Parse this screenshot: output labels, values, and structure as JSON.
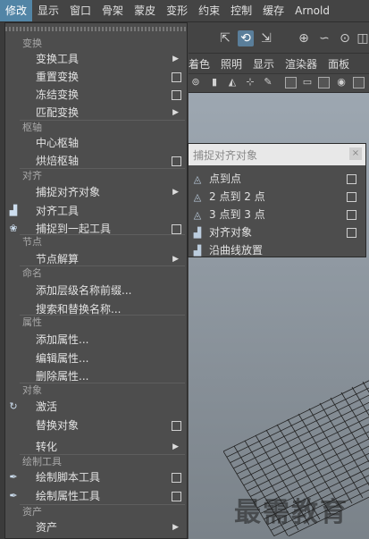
{
  "menubar": {
    "items": [
      "修改",
      "显示",
      "窗口",
      "骨架",
      "蒙皮",
      "变形",
      "约束",
      "控制",
      "缓存",
      "Arnold"
    ],
    "active_index": 0
  },
  "panel": {
    "menus": [
      "着色",
      "照明",
      "显示",
      "渲染器",
      "面板"
    ]
  },
  "menu": {
    "sections": [
      {
        "header": "变换",
        "items": [
          {
            "label": "变换工具",
            "kind": "submenu"
          },
          {
            "label": "重置变换",
            "kind": "option"
          },
          {
            "label": "冻结变换",
            "kind": "option"
          },
          {
            "label": "匹配变换",
            "kind": "submenu"
          }
        ]
      },
      {
        "header": "枢轴",
        "items": [
          {
            "label": "中心枢轴",
            "kind": "plain"
          },
          {
            "label": "烘焙枢轴",
            "kind": "option"
          }
        ]
      },
      {
        "header": "对齐",
        "items": [
          {
            "label": "捕捉对齐对象",
            "kind": "submenu"
          },
          {
            "label": "对齐工具",
            "kind": "plain",
            "icon": "align-tool-icon"
          },
          {
            "label": "捕捉到一起工具",
            "kind": "option",
            "icon": "snap-together-icon"
          }
        ]
      },
      {
        "header": "节点",
        "items": [
          {
            "label": "节点解算",
            "kind": "submenu"
          }
        ]
      },
      {
        "header": "命名",
        "items": [
          {
            "label": "添加层级名称前缀...",
            "kind": "plain"
          },
          {
            "label": "搜索和替换名称...",
            "kind": "plain"
          }
        ]
      },
      {
        "header": "属性",
        "items": [
          {
            "label": "添加属性...",
            "kind": "plain"
          },
          {
            "label": "编辑属性...",
            "kind": "plain"
          },
          {
            "label": "删除属性...",
            "kind": "plain"
          }
        ]
      },
      {
        "header": "对象",
        "items": [
          {
            "label": "激活",
            "kind": "plain",
            "icon": "activate-icon"
          },
          {
            "label": "替换对象",
            "kind": "option"
          },
          {
            "label": "转化",
            "kind": "submenu"
          }
        ]
      },
      {
        "header": "绘制工具",
        "items": [
          {
            "label": "绘制脚本工具",
            "kind": "option",
            "icon": "paint-script-icon"
          },
          {
            "label": "绘制属性工具",
            "kind": "option",
            "icon": "paint-attribute-icon"
          }
        ]
      },
      {
        "header": "资产",
        "items": [
          {
            "label": "资产",
            "kind": "submenu"
          }
        ]
      }
    ]
  },
  "submenu": {
    "title": "捕捉对齐对象",
    "close_label": "×",
    "items": [
      {
        "label": "点到点",
        "option": true
      },
      {
        "label": "2 点到 2 点",
        "option": true
      },
      {
        "label": "3 点到 3 点",
        "option": true
      },
      {
        "label": "对齐对象",
        "option": true
      },
      {
        "label": "沿曲线放置",
        "option": false
      }
    ]
  },
  "watermark": "最需教育",
  "colors": {
    "menu_bg": "#4d4d4d",
    "active": "#5285a6",
    "section": "#a8a8a8"
  }
}
